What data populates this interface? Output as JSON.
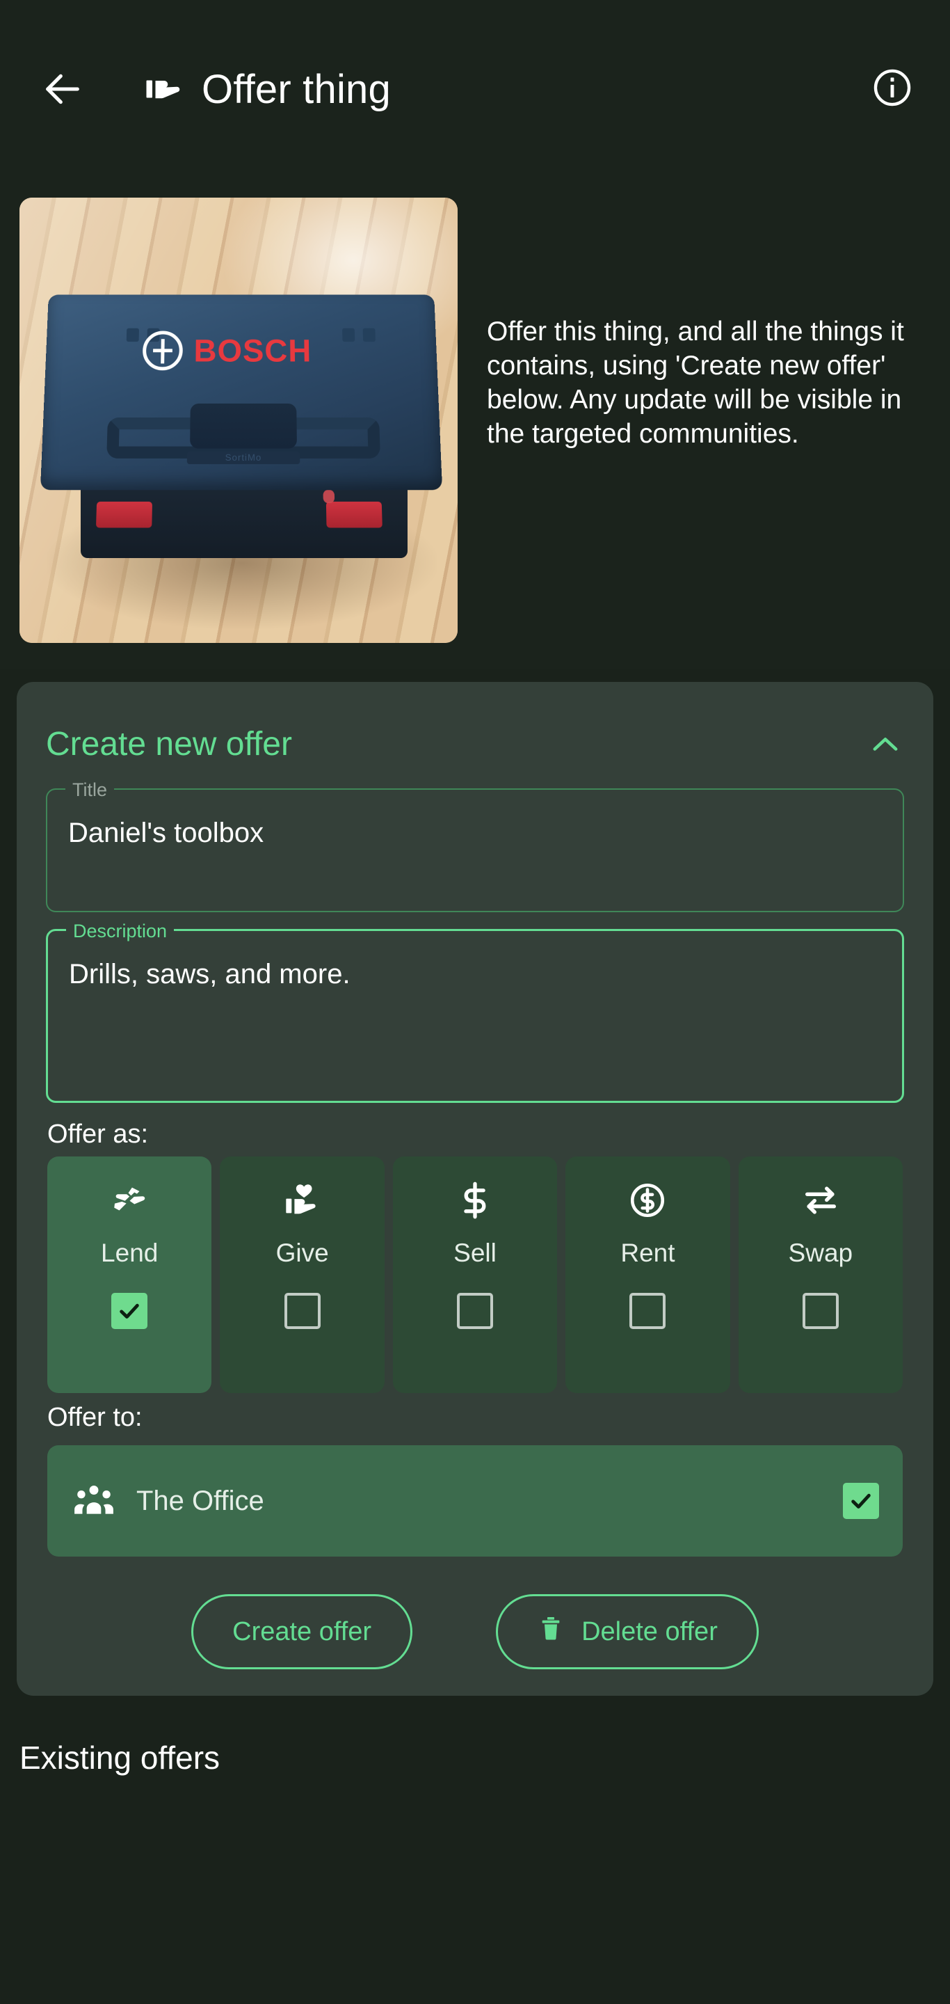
{
  "appbar": {
    "back_icon": "arrow-left-icon",
    "title_icon": "offer-hand-icon",
    "title": "Offer thing",
    "info_icon": "info-circle-icon"
  },
  "hero": {
    "photo_alt": "Bosch L-Boxx blue tool case on a wooden floor",
    "photo_brand": "BOSCH",
    "photo_sub": "SortiMo",
    "intro_text": "Offer this thing, and all the things it contains, using 'Create new offer' below. Any update will be visible in the targeted communities."
  },
  "offer_card": {
    "title": "Create new offer",
    "collapse_icon": "chevron-up-icon",
    "title_field": {
      "label": "Title",
      "value": "Daniel's toolbox",
      "placeholder": "Title",
      "focused": false
    },
    "description_field": {
      "label": "Description",
      "value": "Drills, saws, and more.",
      "placeholder": "Description",
      "focused": true
    },
    "offer_as_label": "Offer as:",
    "offer_as_options": [
      {
        "label": "Lend",
        "icon": "hand-exchange-icon",
        "checked": true,
        "checkbox_icon": "check-icon"
      },
      {
        "label": "Give",
        "icon": "hand-heart-icon",
        "checked": false,
        "checkbox_icon": "empty-box-icon"
      },
      {
        "label": "Sell",
        "icon": "dollar-sign-icon",
        "checked": false,
        "checkbox_icon": "empty-box-icon"
      },
      {
        "label": "Rent",
        "icon": "dollar-coin-icon",
        "checked": false,
        "checkbox_icon": "empty-box-icon"
      },
      {
        "label": "Swap",
        "icon": "swap-arrows-icon",
        "checked": false,
        "checkbox_icon": "empty-box-icon"
      }
    ],
    "offer_to_label": "Offer to:",
    "communities": [
      {
        "name": "The Office",
        "icon": "people-group-icon",
        "checked": true
      }
    ],
    "create_button": "Create offer",
    "delete_button": "Delete offer",
    "delete_icon": "trash-icon"
  },
  "footer": {
    "existing_offers_heading": "Existing offers"
  },
  "colors": {
    "page_background": "#1a221b",
    "card_background": "#344039",
    "accent_green": "#63dd92",
    "checkbox_green": "#6fdb8e",
    "chip_selected": "#3c6b4d",
    "chip_unselected": "#2d4a35",
    "field_border": "#3f8758",
    "text_primary": "#ffffff",
    "label_muted": "#9aa69e",
    "brand_red": "#e8393f"
  }
}
